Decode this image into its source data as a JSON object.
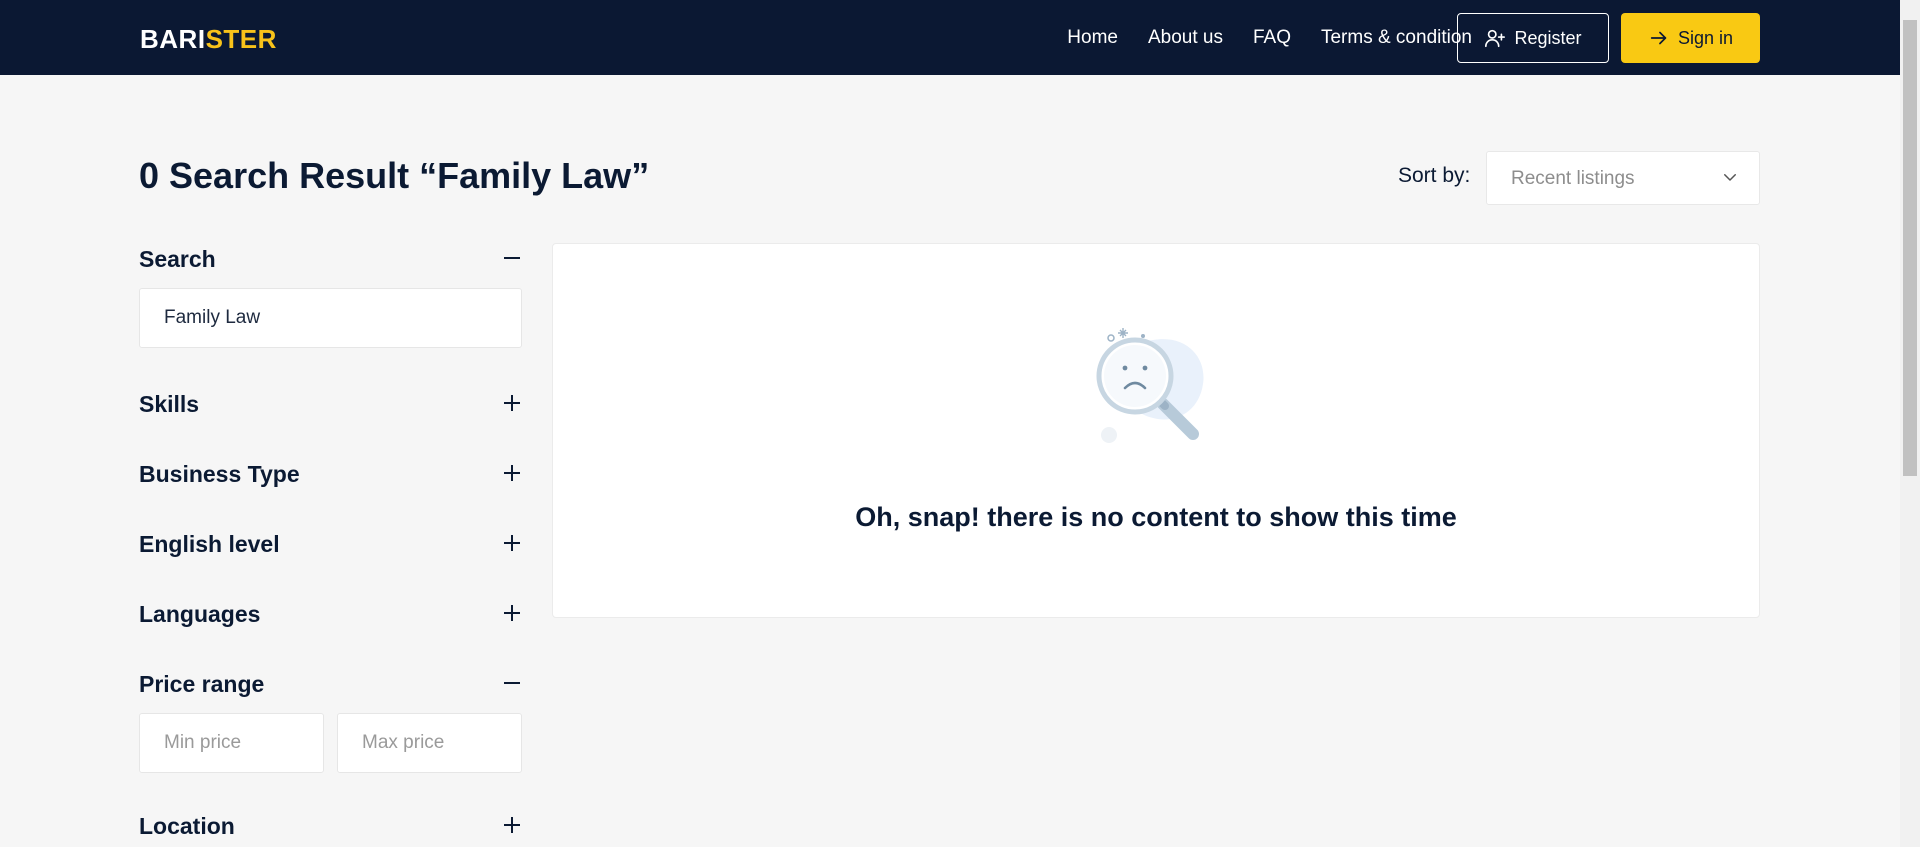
{
  "header": {
    "logo_a": "BARI",
    "logo_b": "STER",
    "nav": [
      "Home",
      "About us",
      "FAQ",
      "Terms & condition"
    ],
    "register_label": "Register",
    "signin_label": "Sign in"
  },
  "main": {
    "title": "0 Search Result “Family Law”",
    "sort_label": "Sort by:",
    "sort_value": "Recent listings",
    "empty_message": "Oh, snap! there is no content to show this time"
  },
  "filters": {
    "search": {
      "title": "Search",
      "value": "Family Law",
      "expanded": true
    },
    "skills": {
      "title": "Skills",
      "expanded": false
    },
    "business_type": {
      "title": "Business Type",
      "expanded": false
    },
    "english_level": {
      "title": "English level",
      "expanded": false
    },
    "languages": {
      "title": "Languages",
      "expanded": false
    },
    "price_range": {
      "title": "Price range",
      "expanded": true,
      "min_placeholder": "Min price",
      "max_placeholder": "Max price"
    },
    "location": {
      "title": "Location",
      "expanded": false
    }
  },
  "colors": {
    "navbar": "#0b1833",
    "accent": "#f9c913",
    "background": "#f6f6f6",
    "text": "#0b1a33"
  },
  "icons": {
    "register": "user-plus-icon",
    "signin": "arrow-right-icon",
    "sort": "chevron-down-icon",
    "collapse": "minus-icon",
    "expand": "plus-icon",
    "empty": "sad-magnifier-icon"
  }
}
